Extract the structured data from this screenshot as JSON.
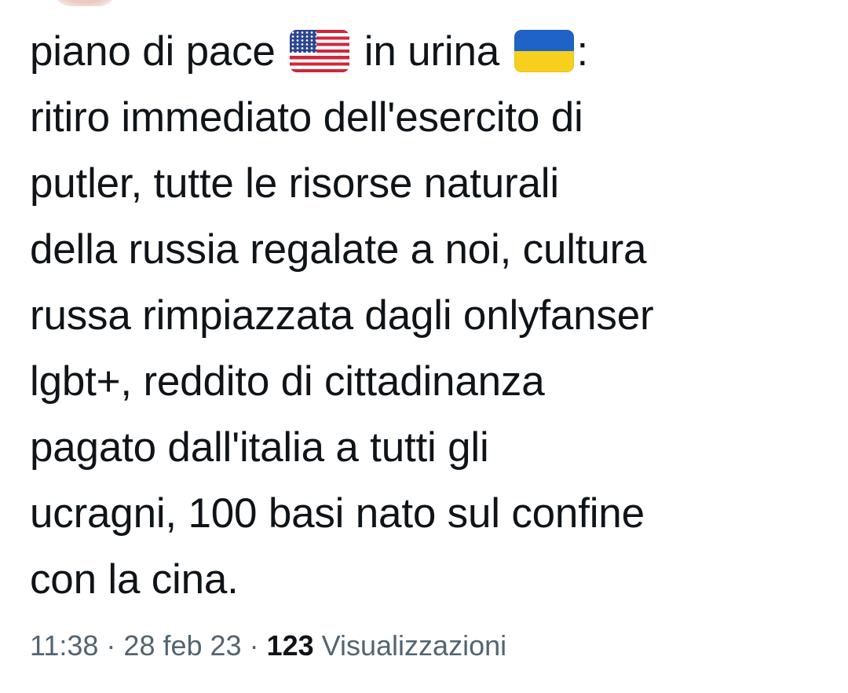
{
  "tweet": {
    "line1": {
      "text_a": "piano di pace",
      "flag_a": "united-states-flag",
      "text_b": "in urina",
      "flag_b": "ukraine-flag",
      "text_c": ":"
    },
    "lines": [
      "ritiro immediato dell'esercito di",
      "putler, tutte le risorse naturali",
      "della russia regalate a noi, cultura",
      "russa rimpiazzata dagli onlyfanser",
      "lgbt+, reddito di cittadinanza",
      "pagato dall'italia a tutti gli",
      "ucragni, 100 basi nato sul confine",
      "con la cina."
    ]
  },
  "meta": {
    "time": "11:38",
    "separator": "·",
    "date": "28 feb 23",
    "views_count": "123",
    "views_label": "Visualizzazioni"
  },
  "colors": {
    "text_primary": "#0f1419",
    "text_secondary": "#536471",
    "background": "#ffffff"
  }
}
